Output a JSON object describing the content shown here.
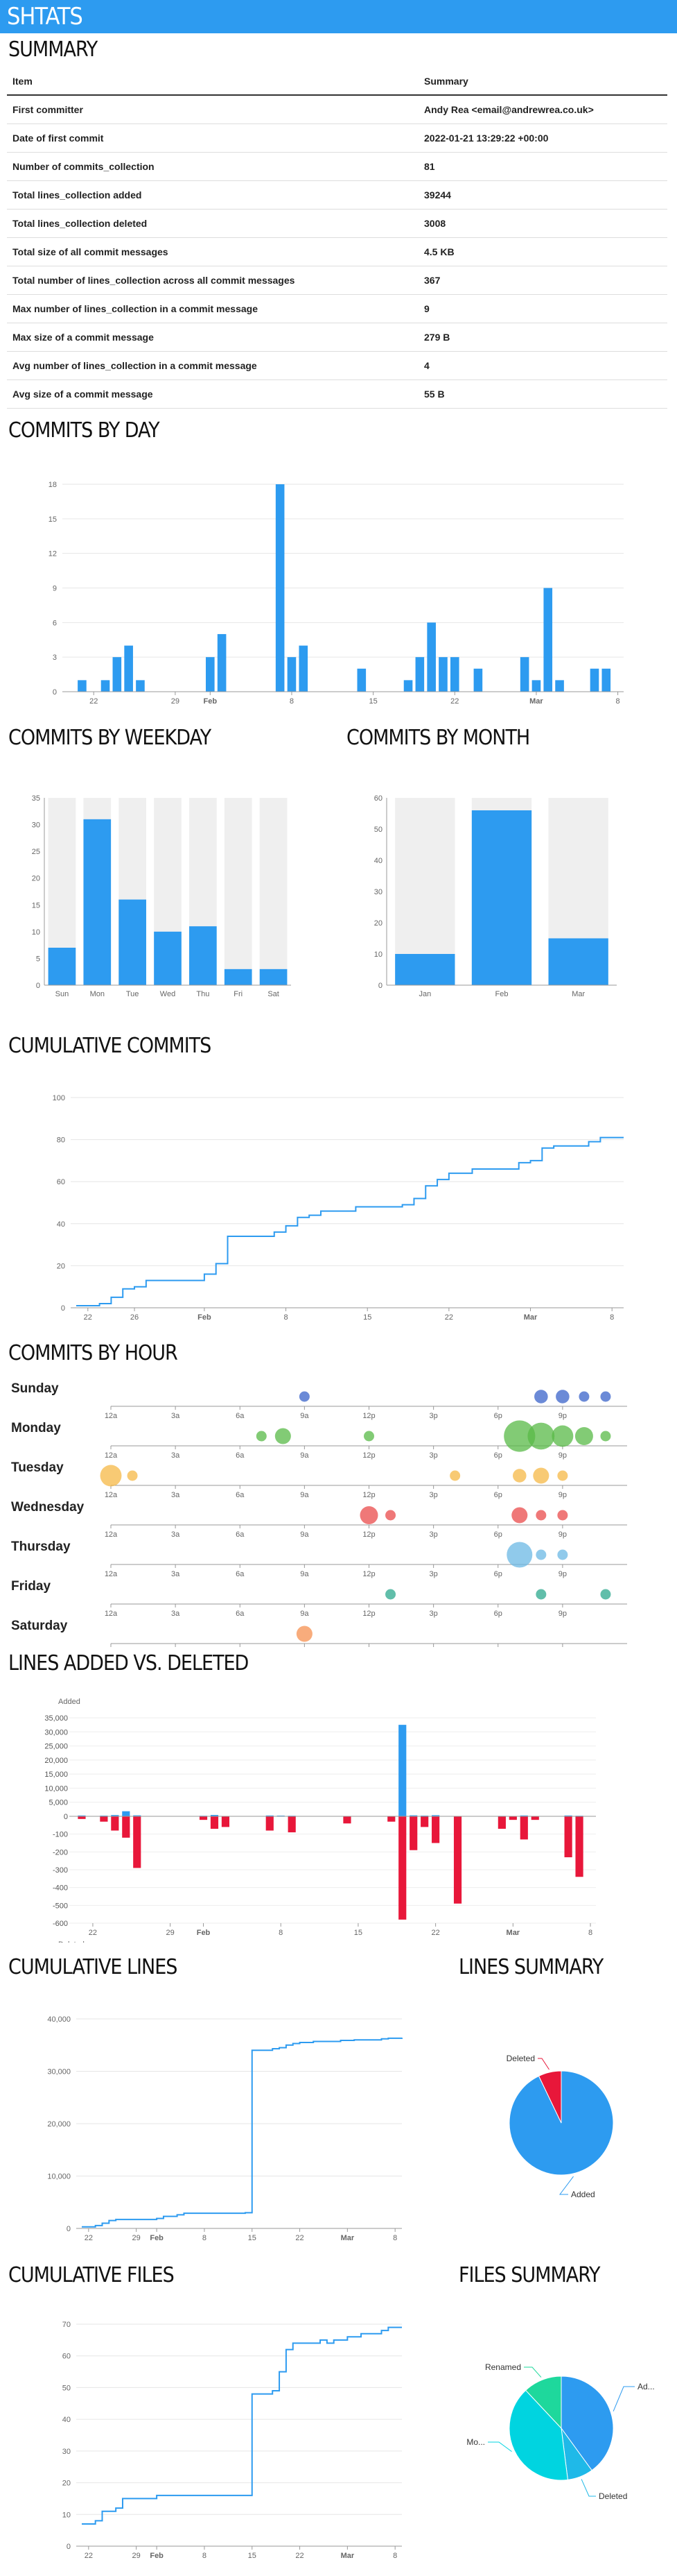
{
  "app": {
    "title": "SHTATS"
  },
  "summary": {
    "heading": "SUMMARY",
    "col_item": "Item",
    "col_summary": "Summary",
    "rows": [
      {
        "item": "First committer",
        "value": "Andy Rea <email@andrewrea.co.uk>"
      },
      {
        "item": "Date of first commit",
        "value": "2022-01-21 13:29:22 +00:00"
      },
      {
        "item": "Number of commits_collection",
        "value": "81"
      },
      {
        "item": "Total lines_collection added",
        "value": "39244"
      },
      {
        "item": "Total lines_collection deleted",
        "value": "3008"
      },
      {
        "item": "Total size of all commit messages",
        "value": "4.5 KB"
      },
      {
        "item": "Total number of lines_collection across all commit messages",
        "value": "367"
      },
      {
        "item": "Max number of lines_collection in a commit message",
        "value": "9"
      },
      {
        "item": "Max size of a commit message",
        "value": "279 B"
      },
      {
        "item": "Avg number of lines_collection in a commit message",
        "value": "4"
      },
      {
        "item": "Avg size of a commit message",
        "value": "55 B"
      }
    ]
  },
  "headings": {
    "by_day": "COMMITS BY DAY",
    "by_weekday": "COMMITS BY WEEKDAY",
    "by_month": "COMMITS BY MONTH",
    "cumulative": "CUMULATIVE COMMITS",
    "by_hour": "COMMITS BY HOUR",
    "lines_av_d": "LINES ADDED VS. DELETED",
    "cum_lines": "CUMULATIVE LINES",
    "lines_summary": "LINES SUMMARY",
    "cum_files": "CUMULATIVE FILES",
    "files_summary": "FILES SUMMARY"
  },
  "colors": {
    "primary": "#2d9bf0",
    "deleted": "#e8173a",
    "bg_bar": "#efefef",
    "header": "#2d9bf0"
  },
  "chart_data": [
    {
      "id": "commits_by_day",
      "type": "bar",
      "ylim": [
        0,
        18
      ],
      "yticks": [
        0,
        3,
        6,
        9,
        12,
        15,
        18
      ],
      "x_start_day": 0,
      "x_end_day": 47,
      "xticks": [
        {
          "day": 1,
          "label": "22"
        },
        {
          "day": 8,
          "label": "29"
        },
        {
          "day": 11,
          "label": "Feb",
          "bold": true
        },
        {
          "day": 18,
          "label": "8"
        },
        {
          "day": 25,
          "label": "15"
        },
        {
          "day": 32,
          "label": "22"
        },
        {
          "day": 39,
          "label": "Mar",
          "bold": true
        },
        {
          "day": 46,
          "label": "8"
        }
      ],
      "points": [
        [
          0,
          1
        ],
        [
          2,
          1
        ],
        [
          3,
          3
        ],
        [
          4,
          4
        ],
        [
          5,
          1
        ],
        [
          11,
          3
        ],
        [
          12,
          5
        ],
        [
          17,
          18
        ],
        [
          18,
          3
        ],
        [
          19,
          4
        ],
        [
          24,
          2
        ],
        [
          28,
          1
        ],
        [
          29,
          3
        ],
        [
          30,
          6
        ],
        [
          31,
          3
        ],
        [
          32,
          3
        ],
        [
          34,
          2
        ],
        [
          38,
          3
        ],
        [
          39,
          1
        ],
        [
          40,
          9
        ],
        [
          41,
          1
        ],
        [
          44,
          2
        ],
        [
          45,
          2
        ]
      ]
    },
    {
      "id": "commits_by_weekday",
      "type": "bar",
      "categories": [
        "Sun",
        "Mon",
        "Tue",
        "Wed",
        "Thu",
        "Fri",
        "Sat"
      ],
      "values": [
        7,
        31,
        16,
        10,
        11,
        3,
        3
      ],
      "ylim": [
        0,
        35
      ],
      "yticks": [
        0,
        5,
        10,
        15,
        20,
        25,
        30,
        35
      ]
    },
    {
      "id": "commits_by_month",
      "type": "bar",
      "categories": [
        "Jan",
        "Feb",
        "Mar"
      ],
      "values": [
        10,
        56,
        15
      ],
      "ylim": [
        0,
        60
      ],
      "yticks": [
        0,
        10,
        20,
        30,
        40,
        50,
        60
      ]
    },
    {
      "id": "cumulative_commits",
      "type": "line",
      "ylim": [
        0,
        100
      ],
      "yticks": [
        0,
        20,
        40,
        60,
        80,
        100
      ],
      "x_start_day": 0,
      "x_end_day": 47,
      "xticks": [
        {
          "day": 1,
          "label": "22"
        },
        {
          "day": 5,
          "label": "26"
        },
        {
          "day": 11,
          "label": "Feb",
          "bold": true
        },
        {
          "day": 18,
          "label": "8"
        },
        {
          "day": 25,
          "label": "15"
        },
        {
          "day": 32,
          "label": "22"
        },
        {
          "day": 39,
          "label": "Mar",
          "bold": true
        },
        {
          "day": 46,
          "label": "8"
        }
      ],
      "points": [
        [
          0,
          1
        ],
        [
          2,
          2
        ],
        [
          3,
          5
        ],
        [
          4,
          9
        ],
        [
          5,
          10
        ],
        [
          6,
          13
        ],
        [
          11,
          16
        ],
        [
          12,
          21
        ],
        [
          13,
          34
        ],
        [
          17,
          36
        ],
        [
          18,
          39
        ],
        [
          19,
          43
        ],
        [
          20,
          44
        ],
        [
          21,
          46
        ],
        [
          24,
          48
        ],
        [
          28,
          49
        ],
        [
          29,
          52
        ],
        [
          30,
          58
        ],
        [
          31,
          61
        ],
        [
          32,
          64
        ],
        [
          34,
          66
        ],
        [
          38,
          69
        ],
        [
          39,
          70
        ],
        [
          40,
          76
        ],
        [
          41,
          77
        ],
        [
          44,
          79
        ],
        [
          45,
          81
        ],
        [
          47,
          81
        ]
      ]
    },
    {
      "id": "commits_by_hour",
      "type": "scatter",
      "hour_ticks": [
        "12a",
        "3a",
        "6a",
        "9a",
        "12p",
        "3p",
        "6p",
        "9p"
      ],
      "rows": [
        {
          "day": "Sunday",
          "color": "#3a63c9",
          "points": [
            [
              9,
              1
            ],
            [
              20,
              2
            ],
            [
              21,
              2
            ],
            [
              22,
              1
            ],
            [
              23,
              1
            ]
          ]
        },
        {
          "day": "Monday",
          "color": "#58b947",
          "points": [
            [
              7,
              1
            ],
            [
              8,
              3
            ],
            [
              12,
              1
            ],
            [
              19,
              14
            ],
            [
              20,
              10
            ],
            [
              21,
              6
            ],
            [
              22,
              4
            ],
            [
              23,
              1
            ]
          ]
        },
        {
          "day": "Tuesday",
          "color": "#f6b846",
          "points": [
            [
              0,
              6
            ],
            [
              1,
              1
            ],
            [
              16,
              1
            ],
            [
              19,
              2
            ],
            [
              20,
              3
            ],
            [
              21,
              1
            ]
          ]
        },
        {
          "day": "Wednesday",
          "color": "#e94b4b",
          "points": [
            [
              12,
              4
            ],
            [
              13,
              1
            ],
            [
              19,
              3
            ],
            [
              20,
              1
            ],
            [
              21,
              1
            ]
          ]
        },
        {
          "day": "Thursday",
          "color": "#6bb8e4",
          "points": [
            [
              19,
              9
            ],
            [
              20,
              1
            ],
            [
              21,
              1
            ]
          ]
        },
        {
          "day": "Friday",
          "color": "#2ca88d",
          "points": [
            [
              13,
              1
            ],
            [
              20,
              1
            ],
            [
              23,
              1
            ]
          ]
        },
        {
          "day": "Saturday",
          "color": "#f59050",
          "points": [
            [
              9,
              3
            ]
          ]
        }
      ]
    },
    {
      "id": "lines_added_vs_deleted",
      "type": "bar",
      "top_label": "Added",
      "bottom_label": "Deleted",
      "added_ticks": [
        0,
        5000,
        10000,
        15000,
        20000,
        25000,
        30000,
        35000
      ],
      "deleted_ticks": [
        0,
        100,
        200,
        300,
        400,
        500,
        600
      ],
      "x_start_day": 0,
      "x_end_day": 47,
      "xticks": [
        {
          "day": 1,
          "label": "22"
        },
        {
          "day": 8,
          "label": "29"
        },
        {
          "day": 11,
          "label": "Feb",
          "bold": true
        },
        {
          "day": 18,
          "label": "8"
        },
        {
          "day": 25,
          "label": "15"
        },
        {
          "day": 32,
          "label": "22"
        },
        {
          "day": 39,
          "label": "Mar",
          "bold": true
        },
        {
          "day": 46,
          "label": "8"
        }
      ],
      "added": [
        [
          0,
          300
        ],
        [
          2,
          250
        ],
        [
          3,
          450
        ],
        [
          4,
          1800
        ],
        [
          5,
          350
        ],
        [
          11,
          200
        ],
        [
          12,
          480
        ],
        [
          17,
          300
        ],
        [
          18,
          250
        ],
        [
          19,
          200
        ],
        [
          24,
          120
        ],
        [
          28,
          90
        ],
        [
          29,
          32500
        ],
        [
          30,
          350
        ],
        [
          31,
          250
        ],
        [
          32,
          400
        ],
        [
          34,
          120
        ],
        [
          38,
          150
        ],
        [
          39,
          100
        ],
        [
          40,
          300
        ],
        [
          41,
          80
        ],
        [
          44,
          300
        ],
        [
          45,
          200
        ]
      ],
      "deleted": [
        [
          0,
          15
        ],
        [
          2,
          30
        ],
        [
          3,
          80
        ],
        [
          4,
          120
        ],
        [
          5,
          290
        ],
        [
          11,
          20
        ],
        [
          12,
          70
        ],
        [
          13,
          60
        ],
        [
          17,
          80
        ],
        [
          19,
          90
        ],
        [
          24,
          40
        ],
        [
          28,
          30
        ],
        [
          29,
          580
        ],
        [
          30,
          190
        ],
        [
          31,
          60
        ],
        [
          32,
          150
        ],
        [
          34,
          490
        ],
        [
          38,
          70
        ],
        [
          39,
          20
        ],
        [
          40,
          130
        ],
        [
          41,
          20
        ],
        [
          44,
          230
        ],
        [
          45,
          340
        ]
      ]
    },
    {
      "id": "cumulative_lines",
      "type": "line",
      "ylim": [
        0,
        40000
      ],
      "yticks": [
        0,
        10000,
        20000,
        30000,
        40000
      ],
      "ytick_labels": [
        "0",
        "10,000",
        "20,000",
        "30,000",
        "40,000"
      ],
      "x_start_day": 0,
      "x_end_day": 47,
      "xticks": [
        {
          "day": 1,
          "label": "22"
        },
        {
          "day": 8,
          "label": "29"
        },
        {
          "day": 11,
          "label": "Feb",
          "bold": true
        },
        {
          "day": 18,
          "label": "8"
        },
        {
          "day": 25,
          "label": "15"
        },
        {
          "day": 32,
          "label": "22"
        },
        {
          "day": 39,
          "label": "Mar",
          "bold": true
        },
        {
          "day": 46,
          "label": "8"
        }
      ],
      "points": [
        [
          0,
          300
        ],
        [
          2,
          550
        ],
        [
          3,
          1000
        ],
        [
          4,
          1500
        ],
        [
          5,
          1700
        ],
        [
          11,
          1900
        ],
        [
          12,
          2300
        ],
        [
          14,
          2600
        ],
        [
          15,
          2900
        ],
        [
          24,
          3000
        ],
        [
          25,
          34000
        ],
        [
          28,
          34300
        ],
        [
          29,
          34500
        ],
        [
          30,
          35000
        ],
        [
          31,
          35300
        ],
        [
          32,
          35500
        ],
        [
          34,
          35700
        ],
        [
          38,
          35900
        ],
        [
          40,
          36000
        ],
        [
          44,
          36200
        ],
        [
          45,
          36300
        ],
        [
          47,
          36400
        ]
      ]
    },
    {
      "id": "lines_summary",
      "type": "pie",
      "slices": [
        {
          "label": "Added",
          "value": 39244,
          "color": "#2d9bf0"
        },
        {
          "label": "Deleted",
          "value": 3008,
          "color": "#e8173a"
        }
      ]
    },
    {
      "id": "cumulative_files",
      "type": "line",
      "ylim": [
        0,
        70
      ],
      "yticks": [
        0,
        10,
        20,
        30,
        40,
        50,
        60,
        70
      ],
      "x_start_day": 0,
      "x_end_day": 47,
      "xticks": [
        {
          "day": 1,
          "label": "22"
        },
        {
          "day": 8,
          "label": "29"
        },
        {
          "day": 11,
          "label": "Feb",
          "bold": true
        },
        {
          "day": 18,
          "label": "8"
        },
        {
          "day": 25,
          "label": "15"
        },
        {
          "day": 32,
          "label": "22"
        },
        {
          "day": 39,
          "label": "Mar",
          "bold": true
        },
        {
          "day": 46,
          "label": "8"
        }
      ],
      "points": [
        [
          0,
          7
        ],
        [
          2,
          8
        ],
        [
          3,
          11
        ],
        [
          5,
          12
        ],
        [
          6,
          15
        ],
        [
          11,
          16
        ],
        [
          12,
          16
        ],
        [
          25,
          48
        ],
        [
          28,
          49
        ],
        [
          29,
          55
        ],
        [
          30,
          62
        ],
        [
          31,
          64
        ],
        [
          33,
          64
        ],
        [
          35,
          65
        ],
        [
          36,
          64
        ],
        [
          37,
          65
        ],
        [
          39,
          66
        ],
        [
          41,
          67
        ],
        [
          44,
          68
        ],
        [
          45,
          69
        ],
        [
          47,
          69
        ]
      ]
    },
    {
      "id": "files_summary",
      "type": "pie",
      "slices": [
        {
          "label": "Ad...",
          "value": 40,
          "color": "#2d9bf0"
        },
        {
          "label": "Deleted",
          "value": 8,
          "color": "#1fb9e8"
        },
        {
          "label": "Mo...",
          "value": 40,
          "color": "#00d4e0"
        },
        {
          "label": "Renamed",
          "value": 12,
          "color": "#1ed89c"
        }
      ]
    }
  ]
}
